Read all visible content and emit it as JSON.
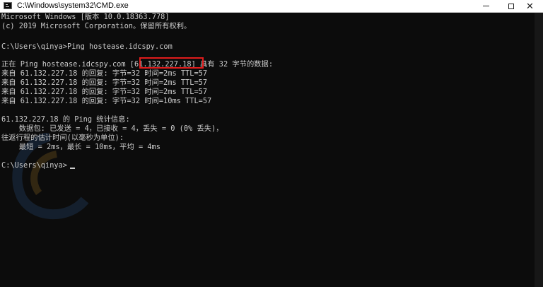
{
  "window": {
    "title": "C:\\Windows\\system32\\CMD.exe"
  },
  "console": {
    "lines": [
      "Microsoft Windows [版本 10.0.18363.778]",
      "(c) 2019 Microsoft Corporation。保留所有权利。",
      "",
      "C:\\Users\\qinya>Ping hostease.idcspy.com",
      "",
      "正在 Ping hostease.idcspy.com [61.132.227.18] 具有 32 字节的数据:",
      "来自 61.132.227.18 的回复: 字节=32 时间=2ms TTL=57",
      "来自 61.132.227.18 的回复: 字节=32 时间=2ms TTL=57",
      "来自 61.132.227.18 的回复: 字节=32 时间=2ms TTL=57",
      "来自 61.132.227.18 的回复: 字节=32 时间=10ms TTL=57",
      "",
      "61.132.227.18 的 Ping 统计信息:",
      "    数据包: 已发送 = 4，已接收 = 4，丢失 = 0 (0% 丢失)，",
      "往返行程的估计时间(以毫秒为单位):",
      "    最短 = 2ms，最长 = 10ms，平均 = 4ms",
      "",
      "C:\\Users\\qinya>"
    ]
  },
  "colors": {
    "background": "#0c0c0c",
    "text": "#cccccc",
    "highlight_border": "#e01c1c"
  }
}
